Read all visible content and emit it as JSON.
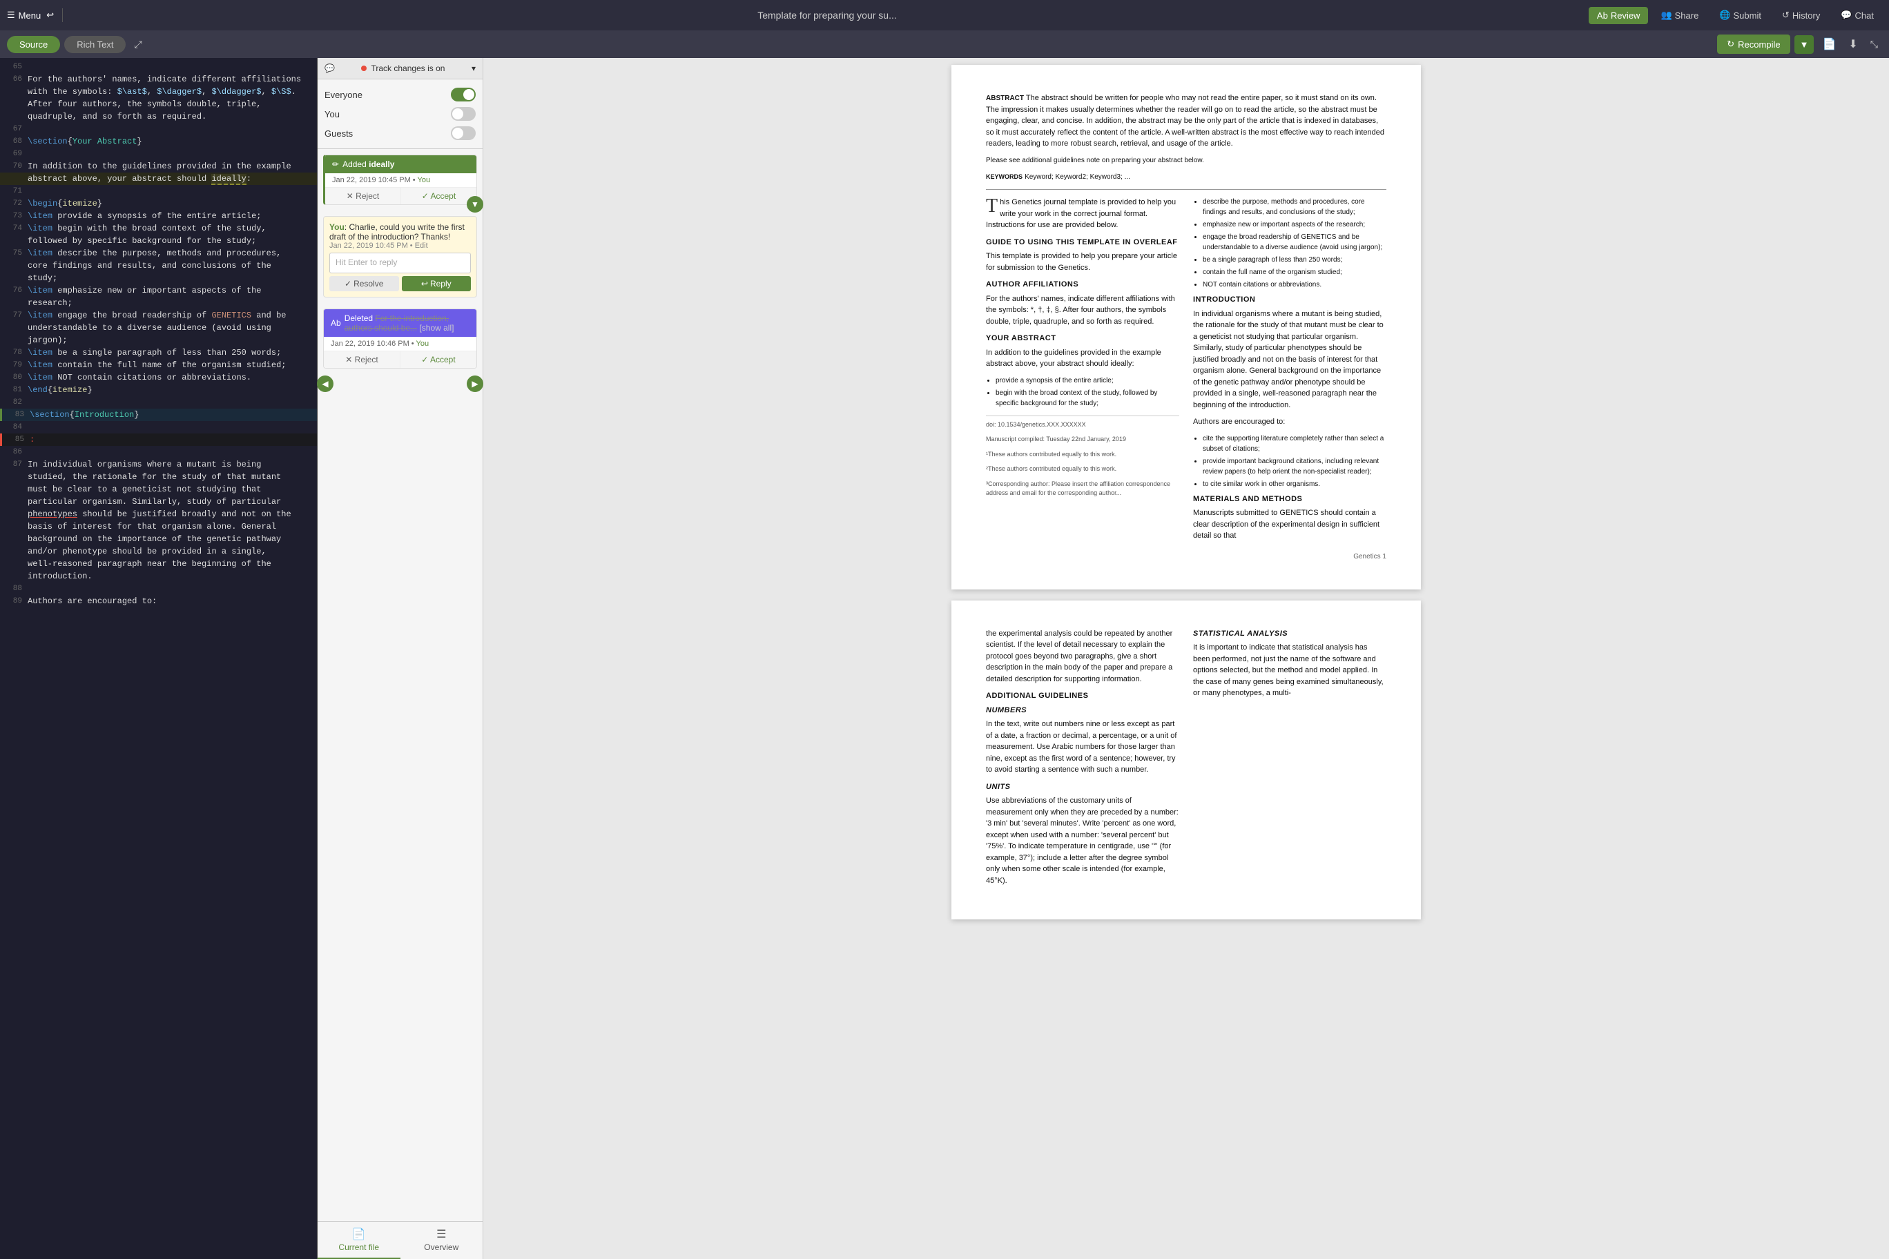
{
  "topbar": {
    "menu_label": "Menu",
    "back_icon": "↩",
    "title": "Template for preparing your su...",
    "review_label": "Review",
    "share_label": "Share",
    "submit_label": "Submit",
    "history_label": "History",
    "chat_label": "Chat"
  },
  "secondbar": {
    "source_label": "Source",
    "rich_text_label": "Rich Text",
    "recompile_label": "Recompile",
    "expand_icon": "⤢",
    "collapse_icon": "⤡"
  },
  "track_changes": {
    "label": "Track changes is on",
    "everyone_label": "Everyone",
    "you_label": "You",
    "guests_label": "Guests"
  },
  "comment1": {
    "action": "Added",
    "word": "ideally",
    "user": "You",
    "date": "Jan 22, 2019 10:45 PM",
    "reject_label": "✕ Reject",
    "accept_label": "✓ Accept"
  },
  "chat1": {
    "user": "You",
    "message": "Charlie, could you write the first draft of the introduction? Thanks!",
    "date": "Jan 22, 2019 10:45 PM",
    "edit_label": "Edit",
    "placeholder": "Hit Enter to reply",
    "resolve_label": "Resolve",
    "reply_label": "Reply"
  },
  "deleted1": {
    "action": "Deleted",
    "text": "For the introduction, authors should be...",
    "show_all": "[show all]",
    "user": "You",
    "date": "Jan 22, 2019 10:46 PM",
    "reject_label": "✕ Reject",
    "accept_label": "✓ Accept"
  },
  "bottom_tabs": {
    "current_file_label": "Current file",
    "overview_label": "Overview"
  },
  "editor": {
    "lines": [
      {
        "num": 65,
        "content": ""
      },
      {
        "num": 66,
        "content": "For the authors' names, indicate different affiliations"
      },
      {
        "num": null,
        "content": "with the symbols: $\\ast$, $\\dagger$, $\\ddagger$, $\\S$."
      },
      {
        "num": null,
        "content": "After four authors, the symbols double, triple,"
      },
      {
        "num": null,
        "content": "quadruple, and so forth as required."
      },
      {
        "num": 67,
        "content": ""
      },
      {
        "num": 68,
        "content": "\\section{Your Abstract}"
      },
      {
        "num": 69,
        "content": ""
      },
      {
        "num": 70,
        "content": "In addition to the guidelines provided in the example"
      },
      {
        "num": null,
        "content": "abstract above, your abstract should ideally:"
      },
      {
        "num": 71,
        "content": ""
      },
      {
        "num": 72,
        "content": "\\begin{itemize}"
      },
      {
        "num": 73,
        "content": "\\item provide a synopsis of the entire article;"
      },
      {
        "num": 74,
        "content": "\\item begin with the broad context of the study,"
      },
      {
        "num": null,
        "content": "followed by specific background for the study;"
      },
      {
        "num": 75,
        "content": "\\item describe the purpose, methods and procedures,"
      },
      {
        "num": null,
        "content": "core findings and results, and conclusions of the"
      },
      {
        "num": null,
        "content": "study;"
      },
      {
        "num": 76,
        "content": "\\item emphasize new or important aspects of the"
      },
      {
        "num": null,
        "content": "research;"
      },
      {
        "num": 77,
        "content": "\\item engage the broad readership of GENETICS and be"
      },
      {
        "num": null,
        "content": "understandable to a diverse audience (avoid using"
      },
      {
        "num": null,
        "content": "jargon);"
      },
      {
        "num": 78,
        "content": "\\item be a single paragraph of less than 250 words;"
      },
      {
        "num": 79,
        "content": "\\item contain the full name of the organism studied;"
      },
      {
        "num": 80,
        "content": "\\item NOT contain citations or abbreviations."
      },
      {
        "num": 81,
        "content": "\\end{itemize}"
      },
      {
        "num": 82,
        "content": ""
      },
      {
        "num": 83,
        "content": "\\section{Introduction}"
      },
      {
        "num": 84,
        "content": ""
      },
      {
        "num": 85,
        "content": ":"
      },
      {
        "num": 86,
        "content": ""
      },
      {
        "num": 87,
        "content": "In individual organisms where a mutant is being"
      },
      {
        "num": null,
        "content": "studied, the rationale for the study of that mutant"
      },
      {
        "num": null,
        "content": "must be clear to a geneticist not studying that"
      },
      {
        "num": null,
        "content": "particular organism. Similarly, study of particular"
      },
      {
        "num": null,
        "content": "phenotypes should be justified broadly and not on the"
      },
      {
        "num": null,
        "content": "basis of interest for that organism alone. General"
      },
      {
        "num": null,
        "content": "background on the importance of the genetic pathway"
      },
      {
        "num": null,
        "content": "and/or phenotype should be provided in a single,"
      },
      {
        "num": null,
        "content": "well-reasoned paragraph near the beginning of the"
      },
      {
        "num": null,
        "content": "introduction."
      },
      {
        "num": 88,
        "content": ""
      },
      {
        "num": 89,
        "content": "Authors are encouraged to:"
      }
    ]
  },
  "preview": {
    "abstract_label": "ABSTRACT",
    "abstract_text": "The abstract should be written for people who may not read the entire paper, so it must stand on its own. The impression it makes usually determines whether the reader will go on to read the article, so the abstract must be engaging, clear, and concise. In addition, the abstract may be the only part of the article that is indexed in databases, so it must accurately reflect the content of the article. A well-written abstract is the most effective way to reach intended readers, leading to more robust search, retrieval, and usage of the article.",
    "abstract_note": "Please see additional guidelines note on preparing your abstract below.",
    "keywords_label": "KEYWORDS",
    "keywords": "Keyword; Keyword2; Keyword3; ...",
    "intro_text1": "his Genetics journal template is provided to help you write your work in the correct journal format. Instructions for use are provided below.",
    "guide_title": "Guide to using this template in Overleaf",
    "guide_text": "This template is provided to help you prepare your article for submission to the Genetics.",
    "affiliations_title": "Author Affiliations",
    "affiliations_text": "For the authors' names, indicate different affiliations with the symbols: *, †, ‡, §. After four authors, the symbols double, triple, quadruple, and so forth as required.",
    "abstract_title": "Your Abstract",
    "abstract_body": "In addition to the guidelines provided in the example abstract above, your abstract should ideally:",
    "bullet1": "provide a synopsis of the entire article;",
    "bullet2": "begin with the broad context of the study, followed by specific background for the study;",
    "doi": "doi: 10.1534/genetics.XXX.XXXXXX",
    "manuscript_date": "Manuscript compiled: Tuesday 22nd January, 2019",
    "footnote1": "¹These authors contributed equally to this work.",
    "footnote2": "²These authors contributed equally to this work.",
    "footnote3": "³Corresponding author: Please insert the affiliation correspondence address and email for the corresponding author...",
    "right_bullets": [
      "describe the purpose, methods and procedures, core findings and results, and conclusions of the study;",
      "emphasize new or important aspects of the research;",
      "engage the broad readership of GENETICS and be understandable to a diverse audience (avoid using jargon);",
      "be a single paragraph of less than 250 words;",
      "contain the full name of the organism studied;",
      "NOT contain citations or abbreviations."
    ],
    "intro_title": "Introduction",
    "intro_body": "In individual organisms where a mutant is being studied, the rationale for the study of that mutant must be clear to a geneticist not studying that particular organism. Similarly, study of particular phenotypes should be justified broadly and not on the basis of interest for that organism alone. General background on the importance of the genetic pathway and/or phenotype should be provided in a single, well-reasoned paragraph near the beginning of the introduction.",
    "authors_encouraged": "Authors are encouraged to:",
    "cite_bullets": [
      "cite the supporting literature completely rather than select a subset of citations;",
      "provide important background citations, including relevant review papers (to help orient the non-specialist reader);",
      "to cite similar work in other organisms."
    ],
    "materials_title": "Materials and Methods",
    "materials_text": "Manuscripts submitted to GENETICS should contain a clear description of the experimental design in sufficient detail so that",
    "page_num": "Genetics 1",
    "page2_intro": "the experimental analysis could be repeated by another scientist. If the level of detail necessary to explain the protocol goes beyond two paragraphs, give a short description in the main body of the paper and prepare a detailed description for supporting information.",
    "additional_title": "Additional guidelines",
    "numbers_title": "Numbers",
    "numbers_text": "In the text, write out numbers nine or less except as part of a date, a fraction or decimal, a percentage, or a unit of measurement. Use Arabic numbers for those larger than nine, except as the first word of a sentence; however, try to avoid starting a sentence with such a number.",
    "units_title": "Units",
    "units_text": "Use abbreviations of the customary units of measurement only when they are preceded by a number: '3 min' but 'several minutes'. Write 'percent' as one word, except when used with a number: 'several percent' but '75%'. To indicate temperature in centigrade, use '°' (for example, 37°); include a letter after the degree symbol only when some other scale is intended (for example, 45°K).",
    "statistical_title": "Statistical Analysis",
    "statistical_text": "It is important to indicate that statistical analysis has been performed, not just the name of the software and options selected, but the method and model applied. In the case of many genes being examined simultaneously, or many phenotypes, a multi-"
  }
}
